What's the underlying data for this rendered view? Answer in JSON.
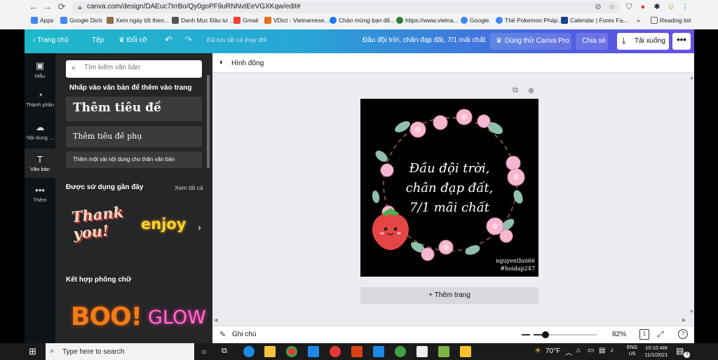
{
  "browser": {
    "url": "canva.com/design/DAEuc7IrrBo/Qy0goPF9uRNNvtEeVGXKqw/edit#",
    "bookmarks": [
      {
        "label": "Apps",
        "color": "#4285f4"
      },
      {
        "label": "Google Dịch",
        "color": "#4285f4"
      },
      {
        "label": "Xem ngày tốt theo...",
        "color": "#8e6b4a"
      },
      {
        "label": "Danh Mục Đầu tư ...",
        "color": "#555555"
      },
      {
        "label": "Gmail",
        "color": "#ea4335"
      },
      {
        "label": "VDict - Vietnamese...",
        "color": "#e8711c"
      },
      {
        "label": "Chào mừng bạn đế...",
        "color": "#1877f2"
      },
      {
        "label": "https://www.vietna...",
        "color": "#2e7d32"
      },
      {
        "label": "Google",
        "color": "#4285f4"
      },
      {
        "label": "Thẻ Pokemon Pháp...",
        "color": "#4285f4"
      },
      {
        "label": "Calendar | Forex Fa...",
        "color": "#1a3e8c"
      }
    ],
    "overflow": "»",
    "reading_list": "Reading list"
  },
  "canva_bar": {
    "home": "Trang chủ",
    "file": "Tệp",
    "resize": "Đổi cỡ",
    "autosave": "Đã lưu tất cả thay đổi",
    "doc_title": "Đầu đội trời, chân đạp đất, 7/1 mãi chất",
    "try_pro": "Dùng thử Canva Pro",
    "share": "Chia sẻ",
    "download": "Tải xuống",
    "more": "•••"
  },
  "rail": [
    {
      "label": "Mẫu",
      "icon": "template-icon"
    },
    {
      "label": "Thành phần",
      "icon": "elements-icon"
    },
    {
      "label": "Nội dung ...",
      "icon": "upload-icon"
    },
    {
      "label": "Văn bản",
      "icon": "text-icon",
      "active": true
    },
    {
      "label": "Thêm",
      "icon": "more-icon"
    }
  ],
  "panel": {
    "search_placeholder": "Tìm kiếm văn bản",
    "add_text_title": "Nhấp vào văn bản để thêm vào trang",
    "add_heading": "Thêm tiêu đề",
    "add_subheading": "Thêm tiêu đề phụ",
    "add_body": "Thêm một vài nội dung cho thân văn bản",
    "recent_title": "Được sử dụng gần đây",
    "see_all": "Xem tất cả",
    "recent_items": [
      "Thank you!",
      "enjoy"
    ],
    "combo_title": "Kết hợp phông chữ",
    "combo_items": [
      "BOO!",
      "GLOW"
    ]
  },
  "editor": {
    "animate": "Hình động",
    "design_lines": [
      "Đầu đội trời,",
      "chân đạp đất,",
      "7/1 mãi chất"
    ],
    "signature": [
      "nguyenthoi66",
      "#hoidap247"
    ],
    "add_page": "+ Thêm trang",
    "notes": "Ghi chú",
    "zoom": "82%",
    "page_number": "1",
    "zoom_level": 0.82
  },
  "taskbar": {
    "search_placeholder": "Type here to search",
    "weather": "70°F",
    "lang": "ENG",
    "region": "US",
    "time": "10:10 AM",
    "date": "11/1/2021",
    "notif_count": "3"
  }
}
